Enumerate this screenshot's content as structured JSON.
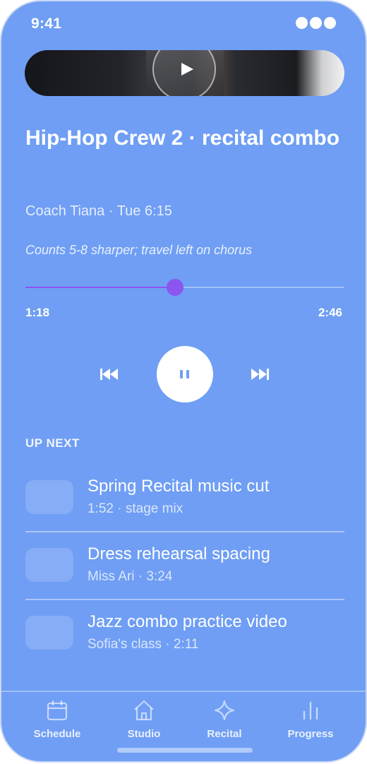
{
  "status_bar": {
    "time": "9:41"
  },
  "video": {
    "play_icon": "play-icon"
  },
  "lesson": {
    "title": "Hip-Hop Crew 2 · recital combo",
    "meta": "Coach Tiana · Tue 6:15",
    "note": "Counts 5-8 sharper; travel left on chorus"
  },
  "player": {
    "elapsed": "1:18",
    "duration": "2:46",
    "progress_fraction": 0.47,
    "accent_color": "#8b55f0",
    "controls": {
      "previous": "skip-back-icon",
      "pause": "pause-icon",
      "next": "skip-forward-icon"
    }
  },
  "up_next": {
    "label": "UP NEXT",
    "items": [
      {
        "title": "Spring Recital music cut",
        "subtitle": "1:52 · stage mix"
      },
      {
        "title": "Dress rehearsal spacing",
        "subtitle": "Miss Ari · 3:24"
      },
      {
        "title": "Jazz combo practice video",
        "subtitle": "Sofia's class · 2:11"
      }
    ]
  },
  "tabs": [
    {
      "label": "Schedule",
      "icon": "calendar-icon"
    },
    {
      "label": "Studio",
      "icon": "home-icon"
    },
    {
      "label": "Recital",
      "icon": "sparkle-icon"
    },
    {
      "label": "Progress",
      "icon": "bar-chart-icon"
    }
  ],
  "colors": {
    "background": "#6f9ef4",
    "accent": "#8b55f0"
  }
}
